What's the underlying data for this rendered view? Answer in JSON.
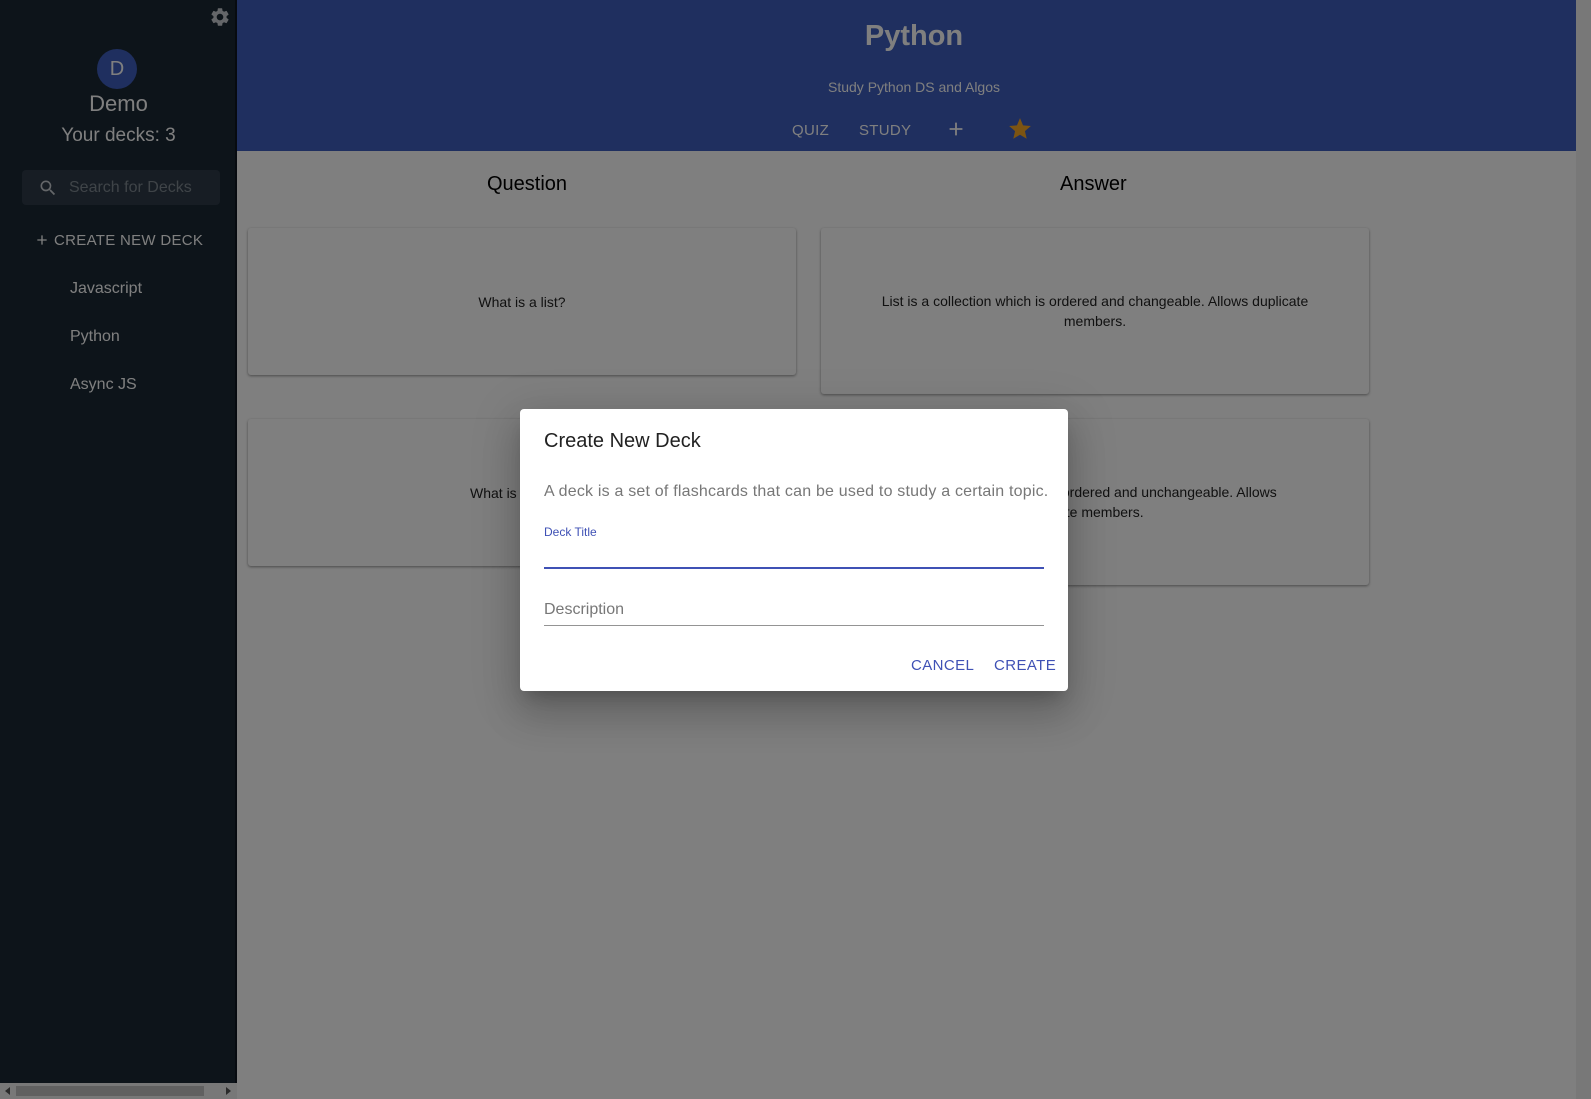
{
  "sidebar": {
    "avatar_initial": "D",
    "user_name": "Demo",
    "deck_count": "Your decks: 3",
    "search_placeholder": "Search for Decks",
    "create_label": "CREATE NEW DECK",
    "decks": [
      "Javascript",
      "Python",
      "Async JS"
    ]
  },
  "header": {
    "title": "Python",
    "subtitle": "Study Python DS and Algos",
    "nav": {
      "quiz": "QUIZ",
      "study": "STUDY"
    },
    "star_color": "#f9a825",
    "accent": "#3f5fbf"
  },
  "main": {
    "question_head": "Question",
    "answer_head": "Answer",
    "cards": [
      {
        "question": "What is a list?",
        "answer": "List is a collection which is ordered and changeable. Allows duplicate members."
      },
      {
        "question": "What is",
        "answer": "s ordered and unchangeable. Allows\ncate members."
      }
    ]
  },
  "dialog": {
    "title": "Create New Deck",
    "description": "A deck is a set of flashcards that can be used to study a certain topic.",
    "title_label": "Deck Title",
    "title_value": "",
    "description_placeholder": "Description",
    "cancel": "CANCEL",
    "create": "CREATE"
  },
  "icons": [
    "gear-icon",
    "search-icon",
    "plus-icon",
    "add-icon",
    "star-icon"
  ]
}
